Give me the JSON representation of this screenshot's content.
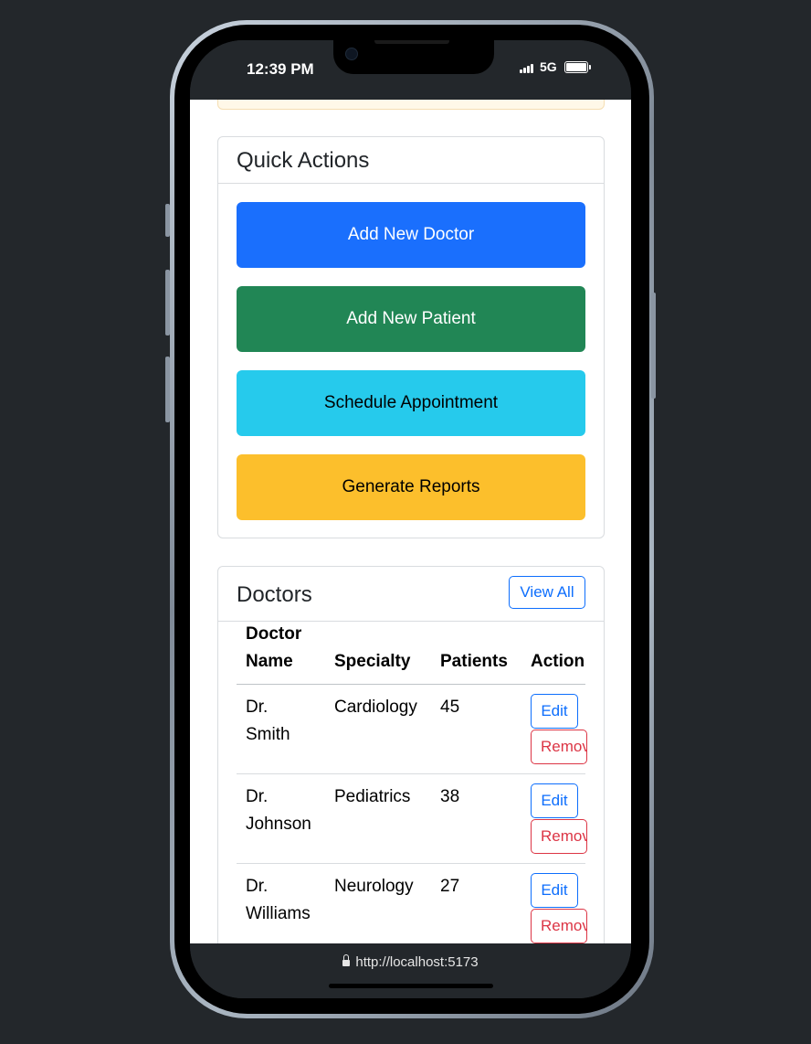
{
  "status_bar": {
    "time": "12:39 PM",
    "network": "5G"
  },
  "quick_actions": {
    "title": "Quick Actions",
    "buttons": [
      {
        "label": "Add New Doctor",
        "color": "#1a6ffd",
        "text_color": "#ffffff"
      },
      {
        "label": "Add New Patient",
        "color": "#218655",
        "text_color": "#ffffff"
      },
      {
        "label": "Schedule Appointment",
        "color": "#26caec",
        "text_color": "#000000"
      },
      {
        "label": "Generate Reports",
        "color": "#fcbf2c",
        "text_color": "#000000"
      }
    ]
  },
  "doctors": {
    "title": "Doctors",
    "view_all_label": "View All",
    "columns": [
      "Doctor Name",
      "Specialty",
      "Patients",
      "Actions"
    ],
    "rows": [
      {
        "name": "Dr. Smith",
        "specialty": "Cardiology",
        "patients": "45"
      },
      {
        "name": "Dr. Johnson",
        "specialty": "Pediatrics",
        "patients": "38"
      },
      {
        "name": "Dr. Williams",
        "specialty": "Neurology",
        "patients": "27"
      }
    ],
    "edit_label": "Edit",
    "remove_label": "Remove"
  },
  "browser": {
    "url": "http://localhost:5173"
  }
}
